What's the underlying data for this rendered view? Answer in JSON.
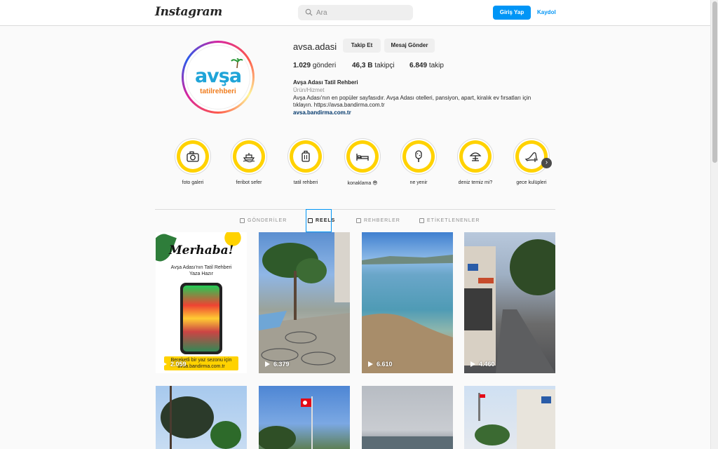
{
  "header": {
    "logo": "Instagram",
    "search_placeholder": "Ara",
    "login_label": "Giriş Yap",
    "signup_label": "Kaydol"
  },
  "profile": {
    "username": "avsa.adasi",
    "follow_label": "Takip Et",
    "message_label": "Mesaj Gönder",
    "avatar_text_main": "avşa",
    "avatar_text_sub": "tatilrehberi",
    "stats": {
      "posts_count": "1.029",
      "posts_label": "gönderi",
      "followers_count": "46,3 B",
      "followers_label": "takipçi",
      "following_count": "6.849",
      "following_label": "takip"
    },
    "bio_name": "Avşa Adası Tatil Rehberi",
    "bio_category": "Ürün/Hizmet",
    "bio_text": "Avşa Adası'nın en popüler sayfasıdır. Avşa Adası otelleri, pansiyon, apart, kiralık ev fırsatları için tıklayın. https://avsa.bandirma.com.tr",
    "bio_link": "avsa.bandirma.com.tr"
  },
  "highlights": [
    {
      "label": "foto galeri",
      "icon": "camera-icon"
    },
    {
      "label": "feribot sefer",
      "icon": "ferry-icon"
    },
    {
      "label": "tatil rehberi",
      "icon": "suitcase-icon"
    },
    {
      "label": "konaklama 😎",
      "icon": "bed-icon"
    },
    {
      "label": "ne yenir",
      "icon": "ice-cream-icon"
    },
    {
      "label": "deniz temiz mi?",
      "icon": "beach-umbrella-icon"
    },
    {
      "label": "gece kulüpleri",
      "icon": "high-heel-icon"
    }
  ],
  "tabs": [
    {
      "label": "GÖNDERİLER",
      "active": false
    },
    {
      "label": "REELS",
      "active": true
    },
    {
      "label": "REHBERLER",
      "active": false
    },
    {
      "label": "ETİKETLENENLER",
      "active": false
    }
  ],
  "promo_tile": {
    "title": "Merhaba!",
    "subtitle_line1": "Avşa Adası'nın Tatil Rehberi",
    "subtitle_line2": "Yaza Hazır",
    "caption_line1": "Bereketli bir yaz sezonu için",
    "caption_line2": "avsa.bandirma.com.tr"
  },
  "reels": [
    {
      "views": "2.059"
    },
    {
      "views": "6.379"
    },
    {
      "views": "6.610"
    },
    {
      "views": "4.460"
    }
  ],
  "colors": {
    "accent": "#0095f6",
    "highlight_ring": "#ffd200"
  }
}
